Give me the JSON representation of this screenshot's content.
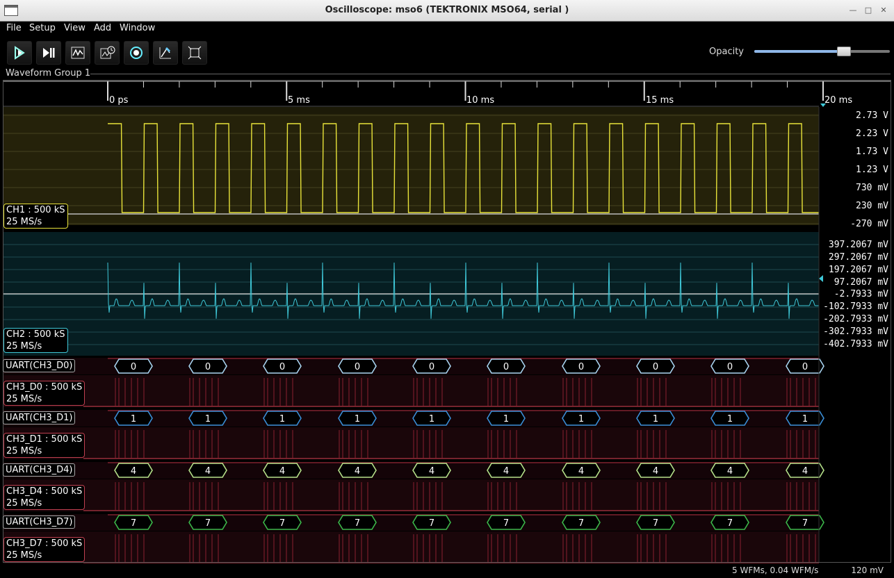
{
  "window": {
    "title": "Oscilloscope: mso6 (TEKTRONIX MSO64, serial              )"
  },
  "menu": [
    "File",
    "Setup",
    "View",
    "Add",
    "Window"
  ],
  "toolbar": {
    "buttons": [
      "run-icon",
      "single-step-icon",
      "waveform-icon",
      "history-icon",
      "trigger-icon",
      "measure-icon",
      "fit-icon"
    ],
    "opacity_label": "Opacity",
    "opacity_value": 0.66
  },
  "group": {
    "label": "Waveform Group 1"
  },
  "timebase": {
    "ticks": [
      "0 ps",
      "5 ms",
      "10 ms",
      "15 ms",
      "20 ms"
    ]
  },
  "channels": {
    "ch1": {
      "label": "CH1 : 500 kS\n25 MS/s",
      "color": "#e8e33a",
      "scale": [
        "2.73 V",
        "2.23 V",
        "1.73 V",
        "1.23 V",
        "730 mV",
        "230 mV",
        "-270 mV"
      ]
    },
    "ch2": {
      "label": "CH2 : 500 kS\n25 MS/s",
      "color": "#3fc8d8",
      "scale": [
        "397.2067 mV",
        "297.2067 mV",
        "197.2067 mV",
        "97.2067 mV",
        "-2.7933 mV",
        "-102.7933 mV",
        "-202.7933 mV",
        "-302.7933 mV",
        "-402.7933 mV"
      ]
    }
  },
  "digital": [
    {
      "proto": "UART(CH3_D0)",
      "value": "0",
      "color": "#a8d4f0",
      "ch": "CH3_D0 : 500 kS\n25 MS/s"
    },
    {
      "proto": "UART(CH3_D1)",
      "value": "1",
      "color": "#3a8fd8",
      "ch": "CH3_D1 : 500 kS\n25 MS/s"
    },
    {
      "proto": "UART(CH3_D4)",
      "value": "4",
      "color": "#b6e28a",
      "ch": "CH3_D4 : 500 kS\n25 MS/s"
    },
    {
      "proto": "UART(CH3_D7)",
      "value": "7",
      "color": "#3cb84a",
      "ch": "CH3_D7 : 500 kS\n25 MS/s"
    }
  ],
  "status": {
    "left": "5 WFMs, 0.04 WFM/s",
    "right": "120 mV"
  }
}
